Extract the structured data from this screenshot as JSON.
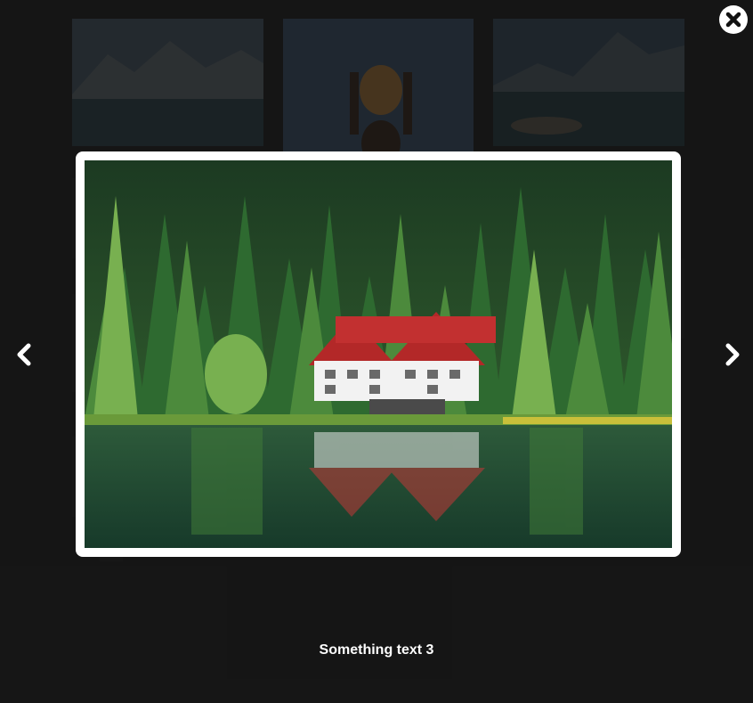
{
  "lightbox": {
    "caption": "Something text 3",
    "image_subject": "white-house-red-roof-by-lake-with-pine-forest",
    "frame_color": "#ffffff"
  },
  "controls": {
    "close_icon": "close-icon",
    "prev_icon": "chevron-left-icon",
    "next_icon": "chevron-right-icon"
  },
  "gallery": {
    "thumbnails": [
      {
        "subject": "mountain-lake"
      },
      {
        "subject": "person-carrying-pot"
      },
      {
        "subject": "mountain-lake-dusk"
      }
    ]
  },
  "colors": {
    "background": "#1b1b1b",
    "overlay": "rgba(20,20,20,0.72)",
    "caption_text": "#ffffff"
  }
}
